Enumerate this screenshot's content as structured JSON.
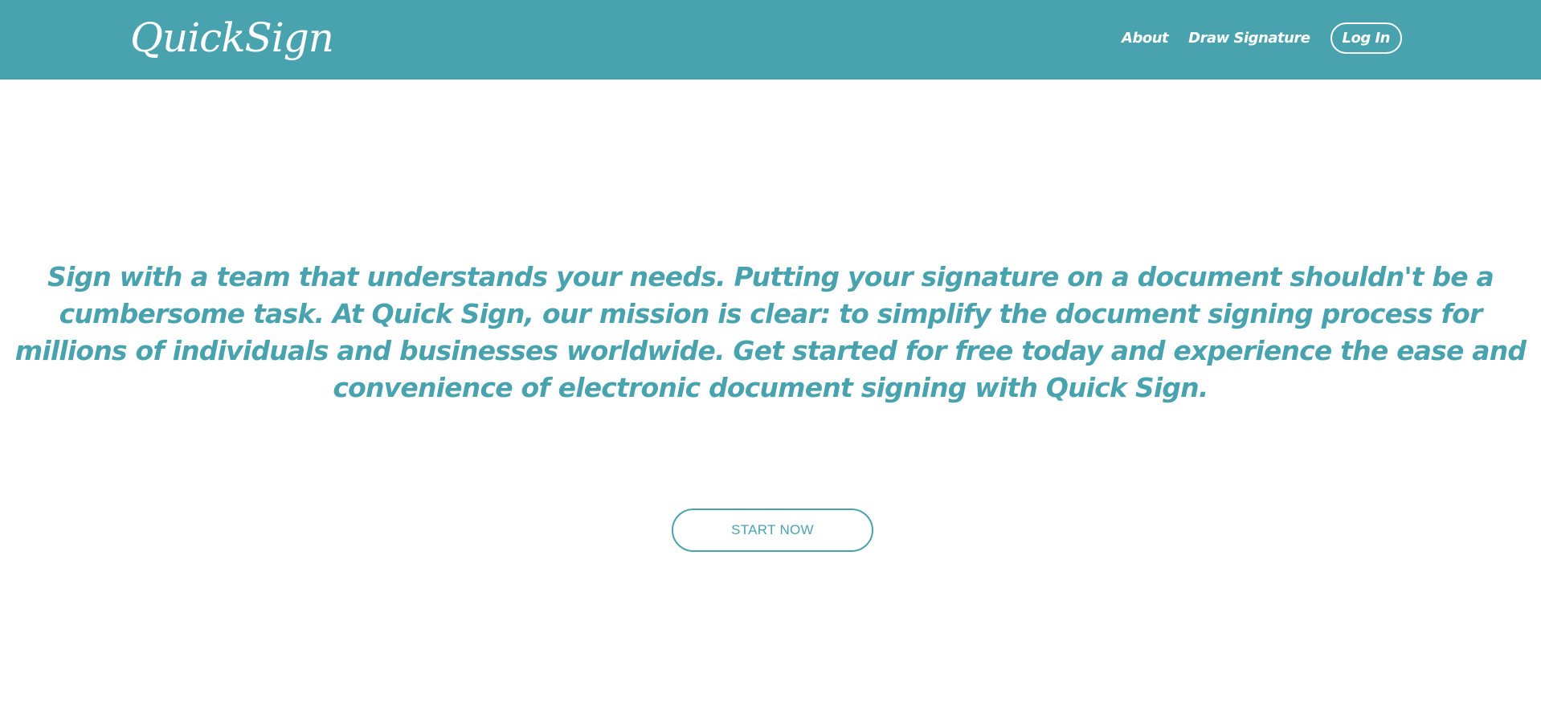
{
  "colors": {
    "accent": "#49a3af",
    "background": "#ffffff",
    "nav_text": "#ffffff"
  },
  "navbar": {
    "brand": "QuickSign",
    "links": [
      {
        "label": "About"
      },
      {
        "label": "Draw Signature"
      }
    ],
    "login_label": "Log In"
  },
  "hero": {
    "text": "Sign with a team that understands your needs. Putting your signature on a document shouldn't be a cumbersome task. At Quick Sign, our mission is clear: to simplify the document signing process for millions of individuals and businesses worldwide. Get started for free today and experience the ease and convenience of electronic document signing with Quick Sign.",
    "cta_label": "START NOW"
  }
}
